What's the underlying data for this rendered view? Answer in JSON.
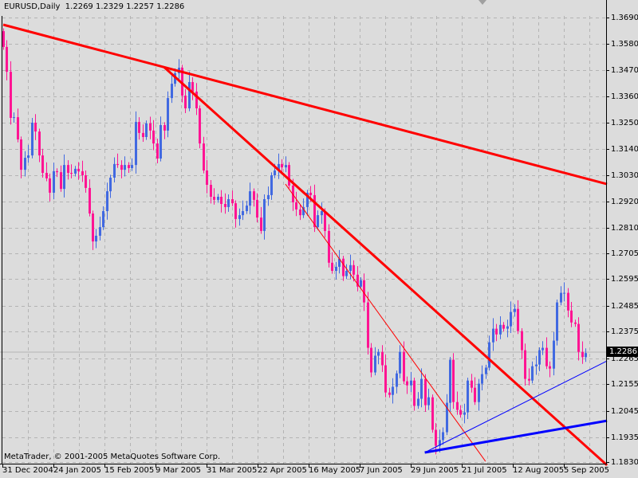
{
  "header": {
    "symbol": "EURUSD,Daily",
    "ohlc": "1.2269 1.2329 1.2257 1.2286"
  },
  "footer": {
    "copyright": "MetaTrader, © 2001-2005 MetaQuotes Software Corp."
  },
  "colors": {
    "background": "#dcdcdc",
    "bull": "#4169e1",
    "bear": "#ff1493",
    "grid": "#b4b4b4",
    "trend_red": "#ff0000",
    "trend_blue": "#0000ff"
  },
  "chart_data": {
    "type": "candlestick",
    "title": "EURUSD,Daily",
    "current_price": "1.2286",
    "ylim": [
      1.183,
      1.369
    ],
    "y_ticks": [
      "1.3690",
      "1.3580",
      "1.3470",
      "1.3360",
      "1.3250",
      "1.3140",
      "1.3030",
      "1.2920",
      "1.2810",
      "1.2705",
      "1.2595",
      "1.2485",
      "1.2375",
      "1.2265",
      "1.2155",
      "1.2045",
      "1.1935",
      "1.1830"
    ],
    "x_ticks": [
      "31 Dec 2004",
      "24 Jan 2005",
      "15 Feb 2005",
      "9 Mar 2005",
      "31 Mar 2005",
      "22 Apr 2005",
      "16 May 2005",
      "7 Jun 2005",
      "29 Jun 2005",
      "21 Jul 2005",
      "12 Aug 2005",
      "5 Sep 2005"
    ],
    "first_open": 1.3633,
    "closes": [
      1.3567,
      1.3463,
      1.327,
      1.3273,
      1.318,
      1.3053,
      1.3103,
      1.3113,
      1.325,
      1.3213,
      1.3113,
      1.304,
      1.3017,
      1.2957,
      1.3047,
      1.3043,
      1.2973,
      1.3073,
      1.304,
      1.3037,
      1.3057,
      1.3047,
      1.303,
      1.2977,
      1.287,
      1.2753,
      1.2777,
      1.2813,
      1.288,
      1.2963,
      1.302,
      1.3077,
      1.3073,
      1.3053,
      1.3073,
      1.306,
      1.3073,
      1.3253,
      1.3207,
      1.319,
      1.3247,
      1.3217,
      1.3163,
      1.31,
      1.324,
      1.3217,
      1.3353,
      1.3413,
      1.3457,
      1.348,
      1.3363,
      1.331,
      1.342,
      1.338,
      1.331,
      1.3163,
      1.305,
      1.299,
      1.294,
      1.2927,
      1.294,
      1.291,
      1.2897,
      1.293,
      1.2913,
      1.2847,
      1.2863,
      1.288,
      1.2903,
      1.2963,
      1.2927,
      1.2853,
      1.2797,
      1.293,
      1.2947,
      1.303,
      1.305,
      1.3077,
      1.3063,
      1.3073,
      1.2987,
      1.2917,
      1.2887,
      1.2863,
      1.2897,
      1.2957,
      1.2947,
      1.2813,
      1.2863,
      1.288,
      1.2797,
      1.2664,
      1.263,
      1.2647,
      1.2681,
      1.2608,
      1.263,
      1.2654,
      1.2614,
      1.2564,
      1.2591,
      1.2498,
      1.2308,
      1.2205,
      1.2275,
      1.2291,
      1.2235,
      1.2121,
      1.2111,
      1.2145,
      1.2201,
      1.2291,
      1.2168,
      1.2151,
      1.2171,
      1.2065,
      1.2095,
      1.2178,
      1.2068,
      1.2101,
      1.1965,
      1.1898,
      1.1922,
      1.1955,
      1.2078,
      1.2258,
      1.2081,
      1.2048,
      1.2028,
      1.2038,
      1.2171,
      1.2141,
      1.2081,
      1.2158,
      1.2198,
      1.2225,
      1.2331,
      1.2388,
      1.2364,
      1.2404,
      1.2388,
      1.2398,
      1.2458,
      1.2471,
      1.2378,
      1.2298,
      1.2178,
      1.2171,
      1.2231,
      1.2238,
      1.2298,
      1.2308,
      1.2231,
      1.2221,
      1.2338,
      1.2498,
      1.2538,
      1.2538,
      1.2464,
      1.2414,
      1.2408,
      1.2291,
      1.2269,
      1.2286
    ],
    "trendlines": [
      {
        "name": "major-resistance",
        "color": "#ff0000",
        "width": 3,
        "from": [
          0,
          1.366
        ],
        "to": [
          169,
          1.2993
        ]
      },
      {
        "name": "steep-resistance",
        "color": "#ff0000",
        "width": 3,
        "from": [
          45,
          1.3483
        ],
        "to": [
          169,
          1.1817
        ]
      },
      {
        "name": "thin-resistance",
        "color": "#ff0000",
        "width": 1,
        "from": [
          79,
          1.2993
        ],
        "to": [
          135,
          1.1833
        ]
      },
      {
        "name": "major-support",
        "color": "#0000ff",
        "width": 3,
        "from": [
          118,
          1.187
        ],
        "to": [
          169,
          1.2003
        ]
      },
      {
        "name": "thin-support",
        "color": "#0000ff",
        "width": 1,
        "from": [
          118,
          1.187
        ],
        "to": [
          169,
          1.2253
        ]
      }
    ]
  }
}
